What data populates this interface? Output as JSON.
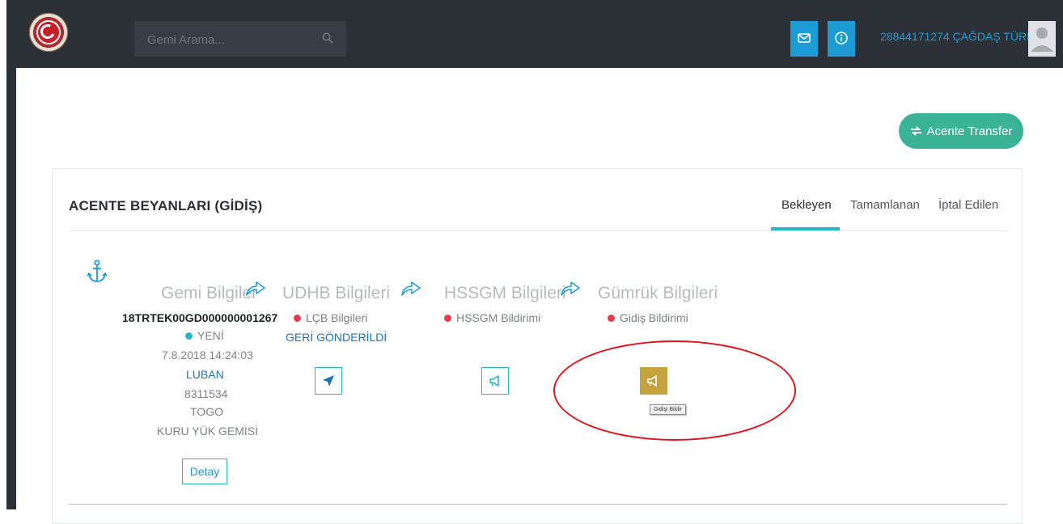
{
  "header": {
    "search_placeholder": "Gemi Arama...",
    "user": "28844171274 ÇAĞDAŞ TÜRE",
    "icons": [
      "logo-emblem",
      "search-icon",
      "mail-icon",
      "info-icon",
      "user-avatar-icon"
    ]
  },
  "actions": {
    "transfer_label": "Acente Transfer"
  },
  "panel": {
    "title": "ACENTE BEYANLARI (GİDİŞ)",
    "tabs": [
      {
        "label": "Bekleyen",
        "active": true
      },
      {
        "label": "Tamamlanan",
        "active": false
      },
      {
        "label": "İptal Edilen",
        "active": false
      }
    ]
  },
  "steps": {
    "gemi": {
      "title": "Gemi Bilgiler",
      "id": "18TRTEK00GD000000001267",
      "status": "YENİ",
      "date": "7.8.2018 14:24:03",
      "ship_name": "LUBAN",
      "imo": "8311534",
      "flag": "TOGO",
      "type": "KURU YÜK GEMİSİ",
      "detail_button": "Detay"
    },
    "udhb": {
      "title": "UDHB Bilgileri",
      "item": "LÇB Bilgileri",
      "status": "GERİ GÖNDERİLDİ"
    },
    "hssgm": {
      "title": "HSSGM Bilgileri",
      "item": "HSSGM Bildirimi"
    },
    "gumruk": {
      "title": "Gümrük Bilgileri",
      "item": "Gidiş Bildirimi",
      "tooltip": "Gidişi Bildir"
    }
  },
  "colors": {
    "topbar": "#2c3138",
    "accent": "#1d9bd4",
    "teal": "#26b6cc",
    "green_button": "#3bb397",
    "gold_button": "#c4a23e",
    "status_red": "#e23d4e",
    "annotation_red": "#e1121b"
  }
}
